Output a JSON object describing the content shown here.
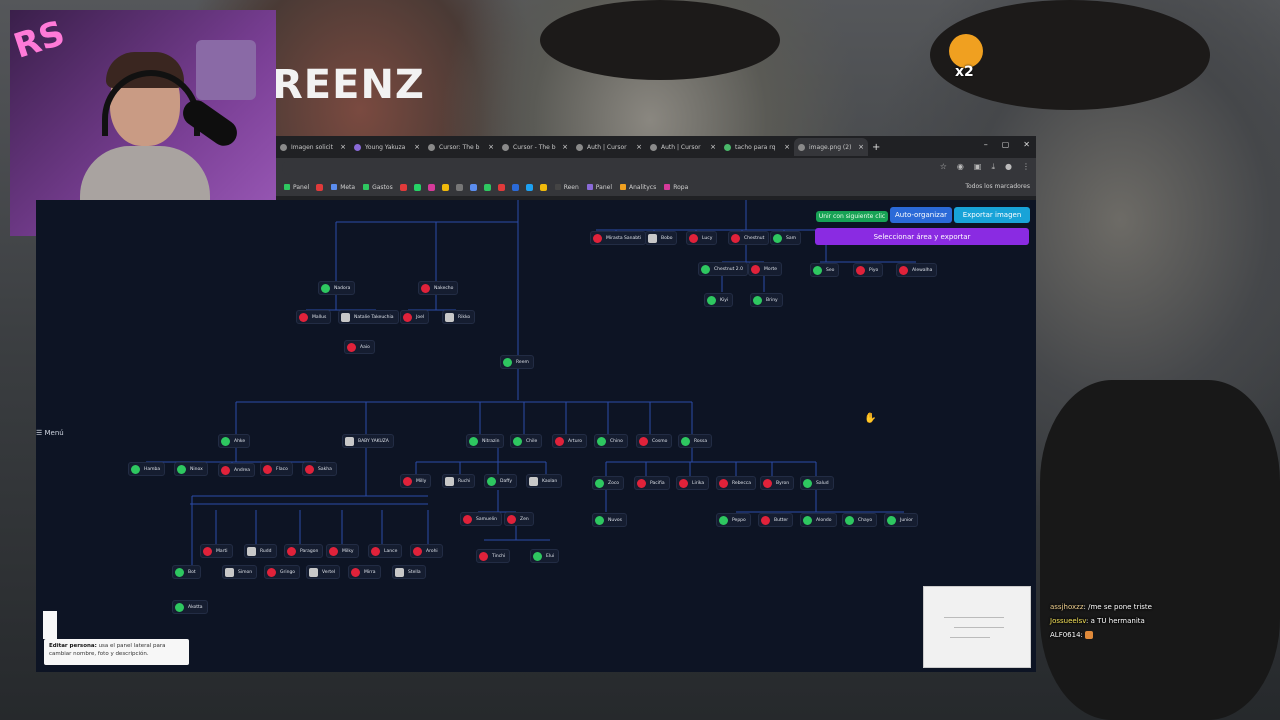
{
  "overlay": {
    "stream_title": "REENZ",
    "badge_text": "x2"
  },
  "browser": {
    "tabs": [
      {
        "label": "Imagen solicit",
        "active": false
      },
      {
        "label": "Young Yakuza",
        "active": false
      },
      {
        "label": "Cursor: The b",
        "active": false
      },
      {
        "label": "Cursor - The b",
        "active": false
      },
      {
        "label": "Auth | Cursor",
        "active": false
      },
      {
        "label": "Auth | Cursor",
        "active": false
      },
      {
        "label": "tacho para rq",
        "active": false
      },
      {
        "label": "image.png (2)",
        "active": true
      }
    ],
    "bookmarks": [
      "Panel",
      "Meta",
      "Gastos",
      "Reen",
      "Panel",
      "Analitycs",
      "Ropa"
    ],
    "bookmarks_all": "Todos los marcadores"
  },
  "toolbar_buttons": {
    "union": "Unir con siguiente clic",
    "auto_organize": "Auto-organizar",
    "export": "Exportar imagen",
    "select_export": "Seleccionar área y exportar"
  },
  "menu_label": "☰ Menú",
  "tooltip": {
    "title": "Editar persona:",
    "text": "usa el panel lateral para cambiar nombre, foto y descripción."
  },
  "nodes": [
    {
      "name": "Mirasta Sanabti",
      "status": "red"
    },
    {
      "name": "Bobo",
      "status": "gray"
    },
    {
      "name": "Lucy",
      "status": "red"
    },
    {
      "name": "Chestnut",
      "status": "red"
    },
    {
      "name": "Sam",
      "status": "green"
    },
    {
      "name": "Chestnut 2.0",
      "status": "green"
    },
    {
      "name": "Morte",
      "status": "red"
    },
    {
      "name": "Seo",
      "status": "green"
    },
    {
      "name": "Piyo",
      "status": "red"
    },
    {
      "name": "Alewalha",
      "status": "red"
    },
    {
      "name": "Kiyi",
      "status": "green"
    },
    {
      "name": "Briny",
      "status": "green"
    },
    {
      "name": "Nadora",
      "status": "green"
    },
    {
      "name": "Nakecho",
      "status": "red"
    },
    {
      "name": "Mallus",
      "status": "red"
    },
    {
      "name": "Natalie Takeuchia",
      "status": "gray"
    },
    {
      "name": "Joel",
      "status": "red"
    },
    {
      "name": "Rikko",
      "status": "gray"
    },
    {
      "name": "Aaio",
      "status": "red"
    },
    {
      "name": "Reem",
      "status": "green"
    },
    {
      "name": "Ahke",
      "status": "green"
    },
    {
      "name": "BABY YAKUZA",
      "status": "gray"
    },
    {
      "name": "Nitrazin",
      "status": "green"
    },
    {
      "name": "Chile",
      "status": "green"
    },
    {
      "name": "Arturo",
      "status": "red"
    },
    {
      "name": "Chino",
      "status": "green"
    },
    {
      "name": "Cosmo",
      "status": "red"
    },
    {
      "name": "Rossa",
      "status": "green"
    },
    {
      "name": "Hamba",
      "status": "green"
    },
    {
      "name": "Ninox",
      "status": "green"
    },
    {
      "name": "Andrea",
      "status": "red"
    },
    {
      "name": "Flaco",
      "status": "red"
    },
    {
      "name": "Sakha",
      "status": "red"
    },
    {
      "name": "Milly",
      "status": "red"
    },
    {
      "name": "Ruchi",
      "status": "gray"
    },
    {
      "name": "Daffy",
      "status": "green"
    },
    {
      "name": "Kaolan",
      "status": "gray"
    },
    {
      "name": "Zoco",
      "status": "green"
    },
    {
      "name": "Pacifia",
      "status": "red"
    },
    {
      "name": "Lirika",
      "status": "red"
    },
    {
      "name": "Rebecca",
      "status": "red"
    },
    {
      "name": "Byron",
      "status": "red"
    },
    {
      "name": "Salud",
      "status": "green"
    },
    {
      "name": "Samuelin",
      "status": "red"
    },
    {
      "name": "Zen",
      "status": "red"
    },
    {
      "name": "Nuvos",
      "status": "green"
    },
    {
      "name": "Peppo",
      "status": "green"
    },
    {
      "name": "Butter",
      "status": "red"
    },
    {
      "name": "Alondo",
      "status": "green"
    },
    {
      "name": "Chayo",
      "status": "green"
    },
    {
      "name": "Junior",
      "status": "green"
    },
    {
      "name": "Tinchi",
      "status": "red"
    },
    {
      "name": "Elui",
      "status": "green"
    },
    {
      "name": "Marti",
      "status": "red"
    },
    {
      "name": "Rudd",
      "status": "gray"
    },
    {
      "name": "Paragon",
      "status": "red"
    },
    {
      "name": "Milky",
      "status": "red"
    },
    {
      "name": "Lance",
      "status": "red"
    },
    {
      "name": "Arohi",
      "status": "red"
    },
    {
      "name": "Bot",
      "status": "green"
    },
    {
      "name": "Simon",
      "status": "gray"
    },
    {
      "name": "Gringo",
      "status": "red"
    },
    {
      "name": "Vertel",
      "status": "gray"
    },
    {
      "name": "Mirra",
      "status": "red"
    },
    {
      "name": "Stella",
      "status": "gray"
    },
    {
      "name": "Akotta",
      "status": "green"
    }
  ],
  "chat": [
    {
      "user": "assjhoxzz",
      "message": "/me se pone triste"
    },
    {
      "user": "Jossueelsv",
      "message": "a TU hermanita"
    },
    {
      "user": "ALF0614",
      "message": ""
    }
  ]
}
